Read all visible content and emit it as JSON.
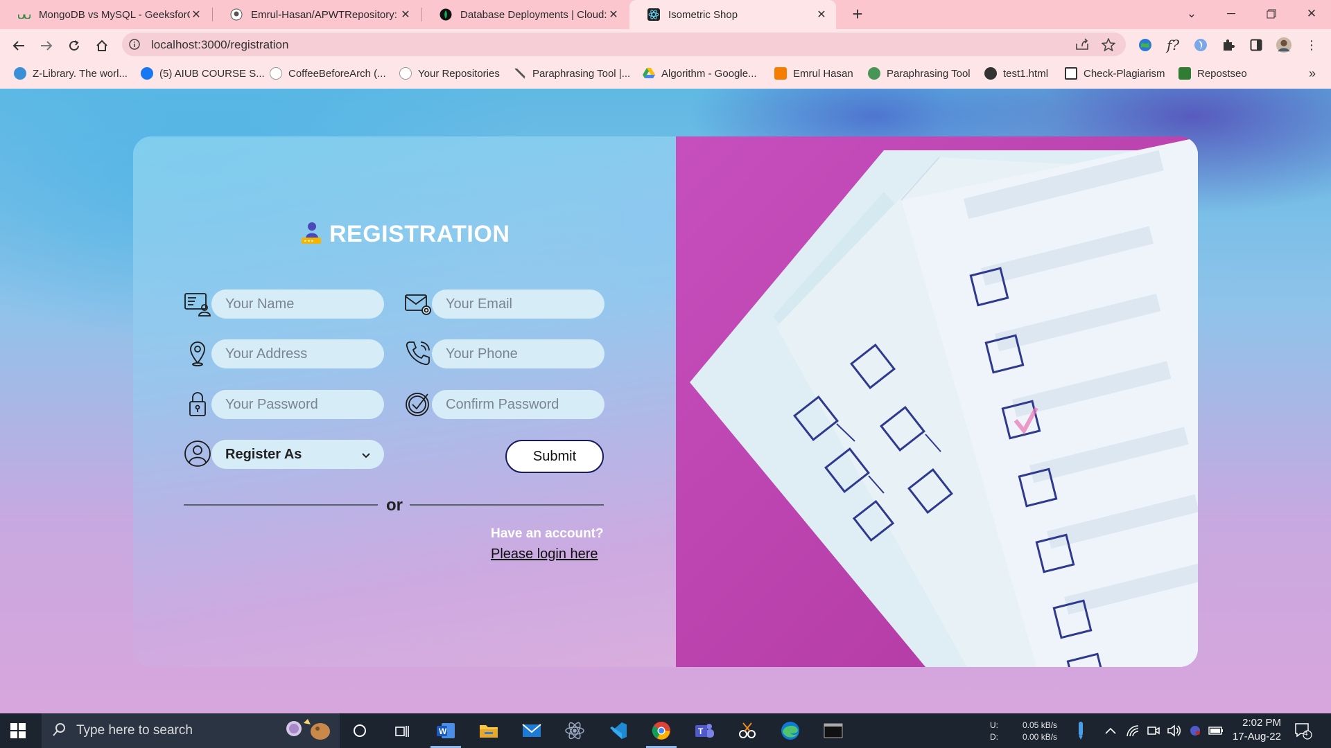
{
  "browser": {
    "tabs": [
      {
        "title": "MongoDB vs MySQL - GeeksforG",
        "favicon": "geeksforgeeks-icon"
      },
      {
        "title": "Emrul-Hasan/APWTRepository: A",
        "favicon": "github-icon"
      },
      {
        "title": "Database Deployments | Cloud: M",
        "favicon": "mongodb-leaf-icon"
      },
      {
        "title": "Isometric Shop",
        "favicon": "react-icon"
      }
    ],
    "active_tab": 3,
    "url": "localhost:3000/registration",
    "bookmarks": [
      {
        "label": "Z-Library. The worl...",
        "icon": "zlibrary-icon",
        "color": "#3a8fd6"
      },
      {
        "label": "(5) AIUB COURSE S...",
        "icon": "facebook-icon",
        "color": "#1877f2"
      },
      {
        "label": "CoffeeBeforeArch (...",
        "icon": "github-icon",
        "color": "#ffffff"
      },
      {
        "label": "Your Repositories",
        "icon": "github-icon",
        "color": "#ffffff"
      },
      {
        "label": "Paraphrasing Tool |...",
        "icon": "quill-icon",
        "color": "#555555"
      },
      {
        "label": "Algorithm - Google...",
        "icon": "google-drive-icon",
        "color": "#34a853"
      },
      {
        "label": "Emrul Hasan",
        "icon": "blogger-icon",
        "color": "#f57d00"
      },
      {
        "label": "Paraphrasing Tool",
        "icon": "quillbot-icon",
        "color": "#499557"
      },
      {
        "label": "test1.html",
        "icon": "globe-icon",
        "color": "#333333"
      },
      {
        "label": "Check-Plagiarism",
        "icon": "document-icon",
        "color": "#333333"
      },
      {
        "label": "Repostseo",
        "icon": "repostseo-icon",
        "color": "#2e7d32"
      }
    ]
  },
  "page": {
    "title": "REGISTRATION",
    "fields": {
      "name": "Your Name",
      "email": "Your Email",
      "address": "Your Address",
      "phone": "Your Phone",
      "password": "Your Password",
      "confirm_password": "Confirm Password"
    },
    "register_as": "Register As",
    "submit_label": "Submit",
    "or_label": "or",
    "have_account": "Have an account?",
    "login_link": "Please login here",
    "colors": {
      "accent_magenta": "#c44bbb",
      "field_bg": "#d6edf8",
      "submit_border": "#1a1a60"
    }
  },
  "taskbar": {
    "search_placeholder": "Type here to search",
    "net_up_label": "U:",
    "net_down_label": "D:",
    "net_up": "0.05 kB/s",
    "net_down": "0.00 kB/s",
    "time": "2:02 PM",
    "date": "17-Aug-22",
    "notification_count": "4",
    "apps": [
      "cortana-icon",
      "task-view-icon",
      "word-icon",
      "file-explorer-icon",
      "mail-icon",
      "atom-icon",
      "vscode-icon",
      "chrome-icon",
      "teams-icon",
      "snipping-tool-icon",
      "edge-icon",
      "terminal-icon"
    ]
  }
}
